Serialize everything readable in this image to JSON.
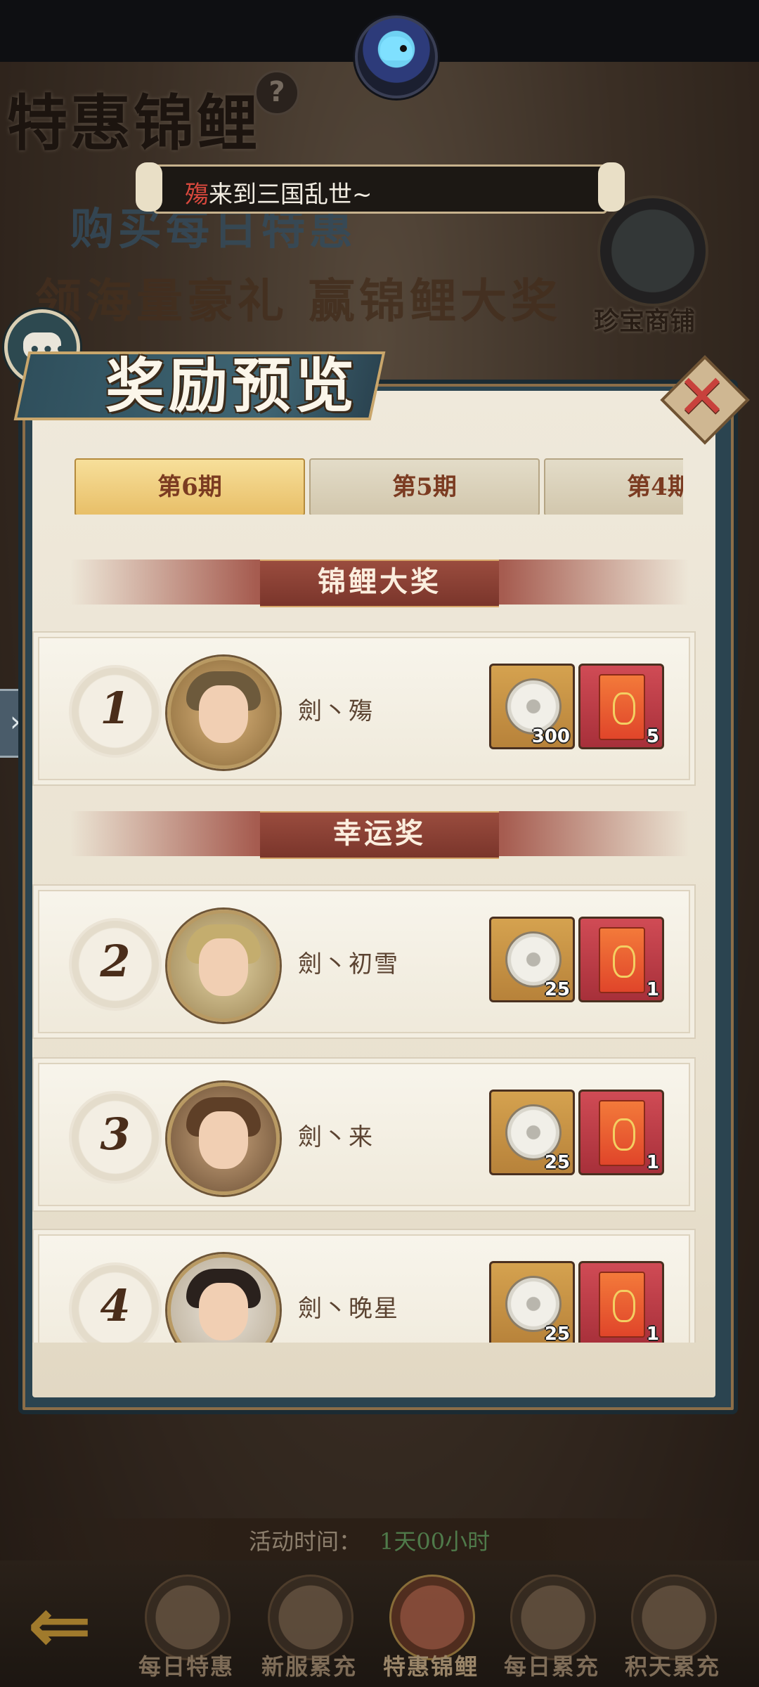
{
  "marquee": {
    "prefix": "殤",
    "text": "来到三国乱世~"
  },
  "background": {
    "title": "特惠锦鲤",
    "slogan_line1": "购买每日特惠",
    "slogan_line2": "领海量豪礼 赢锦鲤大奖",
    "shop_label": "珍宝商铺"
  },
  "modal": {
    "title": "奖励预览",
    "tabs": [
      {
        "label": "第6期",
        "active": true
      },
      {
        "label": "第5期",
        "active": false
      },
      {
        "label": "第4期",
        "active": false
      }
    ],
    "sections": {
      "grand": "锦鲤大奖",
      "lucky": "幸运奖"
    },
    "rows": [
      {
        "rank": "1",
        "name": "劍丶殤",
        "coin_qty": "300",
        "redbag_qty": "5",
        "avatar_color": "#b68b4a"
      },
      {
        "rank": "2",
        "name": "劍丶初雪",
        "coin_qty": "25",
        "redbag_qty": "1",
        "avatar_color": "#c9b27a"
      },
      {
        "rank": "3",
        "name": "劍丶来",
        "coin_qty": "25",
        "redbag_qty": "1",
        "avatar_color": "#7a5a3f"
      },
      {
        "rank": "4",
        "name": "劍丶晚星",
        "coin_qty": "25",
        "redbag_qty": "1",
        "avatar_color": "#2e2622"
      }
    ]
  },
  "activity": {
    "label": "活动时间：",
    "value": "1天00小时"
  },
  "bottom_nav": [
    {
      "label": "每日特惠",
      "active": false
    },
    {
      "label": "新服累充",
      "active": false
    },
    {
      "label": "特惠锦鲤",
      "active": true
    },
    {
      "label": "每日累充",
      "active": false
    },
    {
      "label": "积天累充",
      "active": false
    }
  ],
  "colors": {
    "accent_gold": "#e8bf68",
    "title_red": "#8d3d34",
    "timer_green": "#4f7a4a"
  }
}
